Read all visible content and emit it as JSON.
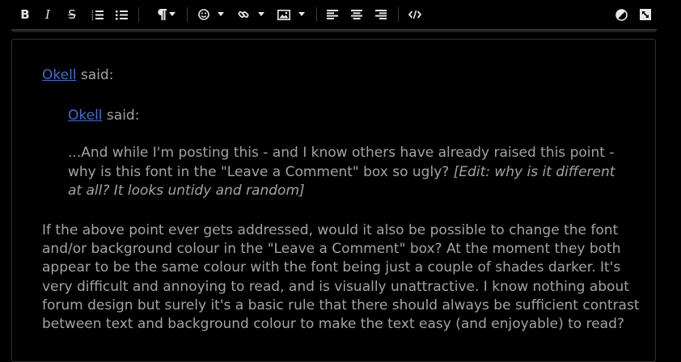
{
  "toolbar": {
    "icons": [
      "bold-icon",
      "italic-icon",
      "strikethrough-icon",
      "ordered-list-icon",
      "unordered-list-icon",
      "paragraph-icon",
      "emoji-icon",
      "link-icon",
      "image-icon",
      "align-left-icon",
      "align-center-icon",
      "align-right-icon",
      "source-code-icon",
      "contrast-icon",
      "fullscreen-icon"
    ],
    "bold": "B",
    "italic": "I",
    "strike": "S"
  },
  "quote": {
    "author": "Okell",
    "said": " said:",
    "inner_quote": {
      "author": "Okell",
      "said": " said:",
      "text": "...And while I'm posting this - and I know others have already raised this point - why is this font in the \"Leave a Comment\" box so ugly?  ",
      "italic_text": "[Edit: why is it different at all?  It looks untidy and random]"
    },
    "body": "If the above point ever gets addressed, would it also be possible to change the font and/or background colour in the \"Leave a Comment\" box?  At the moment they both appear to be the same colour with the font being just a couple of shades darker.  It's very difficult and annoying to read, and is visually unattractive.  I know nothing about forum design but surely it's a basic rule that there should always be sufficient contrast between text and background colour to make the text easy (and enjoyable) to read?"
  },
  "colors": {
    "background": "#000000",
    "text": "#a3a3a3",
    "link": "#3f6fc8",
    "toolbar_icon": "#e6e6e6"
  }
}
